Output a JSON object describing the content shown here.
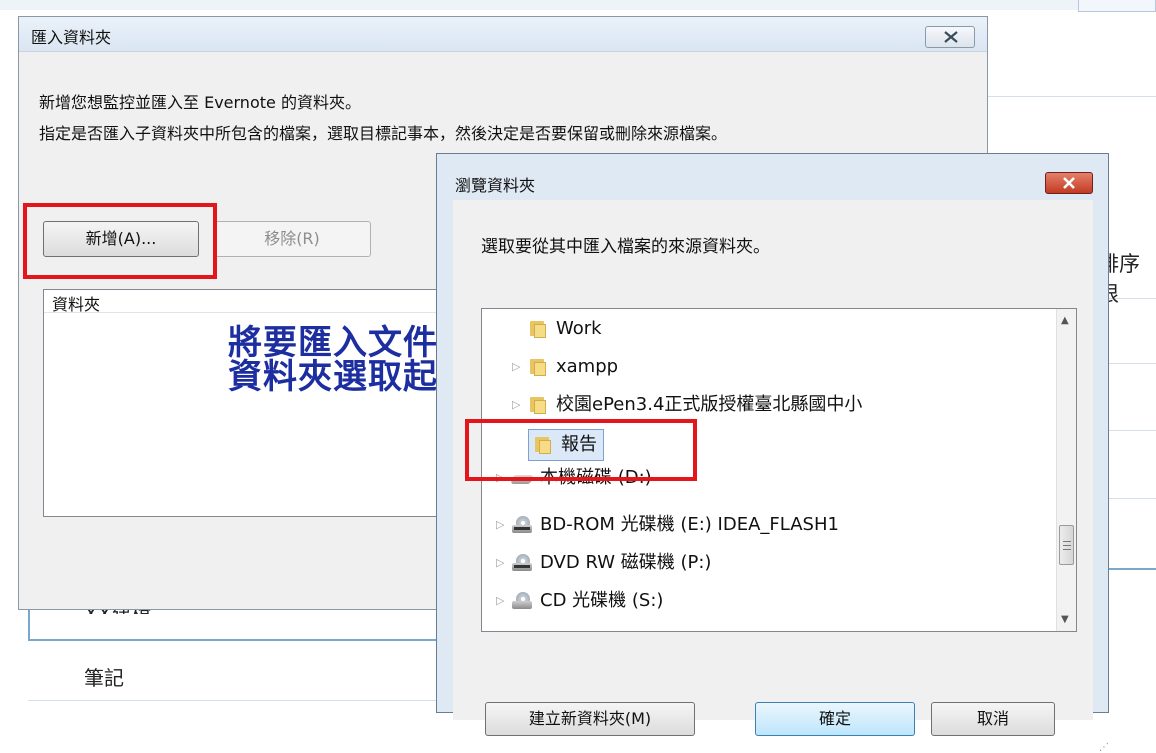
{
  "background_app": {
    "sort_label": "排序根",
    "items": [
      "XX建檔",
      "筆記"
    ]
  },
  "import_dialog": {
    "title": "匯入資料夾",
    "description_line1": "新增您想監控並匯入至 Evernote 的資料夾。",
    "description_line2": "指定是否匯入子資料夾中所包含的檔案，選取目標記事本，然後決定是否要保留或刪除來源檔案。",
    "add_button": "新增(A)...",
    "remove_button": "移除(R)",
    "folder_column_header": "資料夾",
    "close_icon": "close-icon"
  },
  "annotation": {
    "line1": "將要匯入文件的",
    "line2": "資料夾選取起來"
  },
  "browse_dialog": {
    "title": "瀏覽資料夾",
    "instruction": "選取要從其中匯入檔案的來源資料夾。",
    "tree": [
      {
        "label": "Work",
        "icon": "folder-icon",
        "expandable": false
      },
      {
        "label": "xampp",
        "icon": "folder-icon",
        "expandable": true
      },
      {
        "label": "校園ePen3.4正式版授權臺北縣國中小",
        "icon": "folder-icon",
        "expandable": true
      },
      {
        "label": "報告",
        "icon": "folder-icon",
        "expandable": false,
        "selected": true
      },
      {
        "label": "本機磁碟 (D:)",
        "icon": "drive-icon",
        "expandable": true
      },
      {
        "label": "BD-ROM 光碟機 (E:) IDEA_FLASH1",
        "icon": "bd-rom-icon",
        "expandable": true
      },
      {
        "label": "DVD RW 磁碟機 (P:)",
        "icon": "dvd-drive-icon",
        "expandable": true
      },
      {
        "label": "CD 光碟機 (S:)",
        "icon": "cd-drive-icon",
        "expandable": true
      }
    ],
    "new_folder_button": "建立新資料夾(M)",
    "ok_button": "確定",
    "cancel_button": "取消"
  },
  "colors": {
    "highlight_red": "#e4161c",
    "annotation_blue": "#1c2ea0",
    "selection_bg": "#dbe8f8"
  }
}
